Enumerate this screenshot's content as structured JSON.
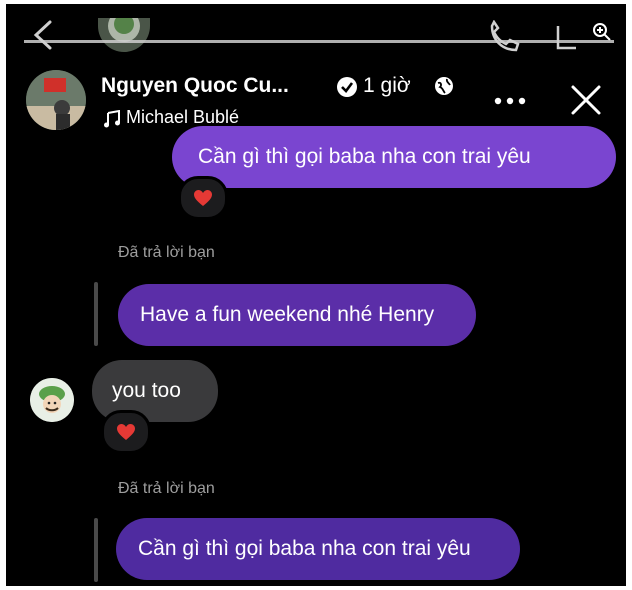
{
  "header": {
    "name": "Nguyen Quoc Cu...",
    "time": "1 giờ",
    "song": "Michael Bublé"
  },
  "messages": [
    {
      "id": "sent1",
      "text": "Cần gì thì gọi baba nha con trai yêu",
      "reaction": "heart"
    },
    {
      "id": "sent2",
      "reply_label": "Đã trả lời bạn",
      "text": "Have a fun weekend nhé Henry"
    },
    {
      "id": "recv1",
      "text": "you too",
      "reaction": "heart"
    },
    {
      "id": "sent3",
      "reply_label": "Đã trả lời bạn",
      "text": "Cần gì thì gọi baba nha con trai yêu"
    }
  ],
  "colors": {
    "background": "#000000",
    "sent_bubble": "#6a3ec2",
    "received_bubble": "#3a3a3c",
    "heart": "#e53935"
  },
  "icons": [
    "back-arrow-icon",
    "phone-icon",
    "video-icon",
    "zoom-icon",
    "verified-icon",
    "globe-icon",
    "music-note-icon",
    "more-icon",
    "close-icon",
    "heart-icon"
  ]
}
